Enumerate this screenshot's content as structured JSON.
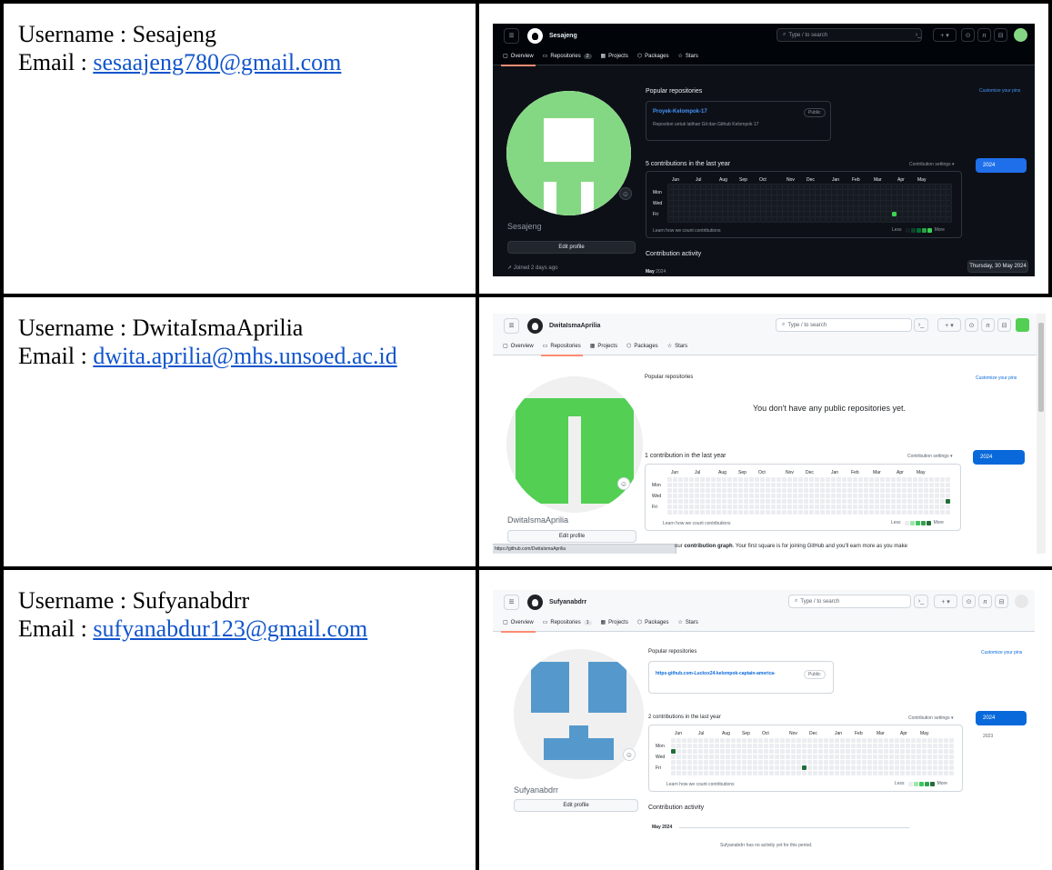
{
  "rows": [
    {
      "username_line": "Username : Sesajeng",
      "email_prefix": "Email : ",
      "email": "sesaajeng780@gmail.com"
    },
    {
      "username_line": "Username : DwitaIsmaAprilia",
      "email_prefix": "Email : ",
      "email": "dwita.aprilia@mhs.unsoed.ac.id"
    },
    {
      "username_line": "Username : Sufyanabdrr",
      "email_prefix": "Email : ",
      "email": "sufyanabdur123@gmail.com"
    }
  ],
  "common": {
    "search_placeholder": "Type / to search",
    "tab_overview": "Overview",
    "tab_repositories": "Repositories",
    "tab_projects": "Projects",
    "tab_packages": "Packages",
    "tab_stars": "Stars",
    "popular_repositories": "Popular repositories",
    "customize_pins": "Customize your pins",
    "contribution_settings": "Contribution settings ▾",
    "learn_count": "Learn how we count contributions",
    "less": "Less",
    "more": "More",
    "edit_profile": "Edit profile",
    "months": [
      "Jun",
      "Jul",
      "Aug",
      "Sep",
      "Oct",
      "Nov",
      "Dec",
      "Jan",
      "Feb",
      "Mar",
      "Apr",
      "May"
    ],
    "days": [
      "Mon",
      "Wed",
      "Fri"
    ],
    "year_selected": "2024"
  },
  "shot1": {
    "username": "Sesajeng",
    "repo_count": "2",
    "repo_name": "Proyek-Kelompok-17",
    "repo_visibility": "Public",
    "repo_desc": "Repositori untuk latihan Git dan Github Kelompok 17",
    "contrib_heading": "5 contributions in the last year",
    "joined": "Joined 2 days ago",
    "activity_heading": "Contribution activity",
    "activity_month": "May",
    "activity_year": "2024",
    "date_badge": "Thursday, 30 May 2024"
  },
  "shot2": {
    "username": "DwitaIsmaAprilia",
    "no_repos": "You don't have any public repositories yet.",
    "contrib_heading": "1 contribution in the last year",
    "status_url": "https://github.com/DwitaIsmaAprilia",
    "footer_prefix": "our ",
    "footer_bold": "contribution graph",
    "footer_rest": ". Your first square is for joining GitHub and you'll earn more as you make"
  },
  "shot3": {
    "username": "Sufyanabdrr",
    "repo_count": "1",
    "repo_name": "https-github.com-Luckxx24-kelompok-captain-america-",
    "repo_visibility": "Public",
    "contrib_heading": "2 contributions in the last year",
    "year_other": "2023",
    "activity_heading": "Contribution activity",
    "activity_month": "May 2024",
    "no_activity": "Sufyanabdrr has no activity yet for this period."
  }
}
